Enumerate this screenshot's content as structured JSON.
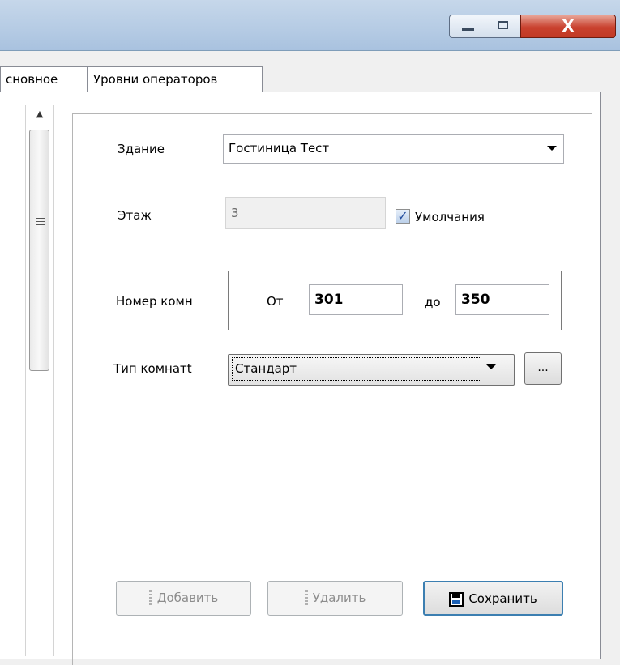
{
  "window": {
    "title_hint": "",
    "controls": {
      "minimize": "minimize",
      "maximize": "maximize",
      "close": "X"
    }
  },
  "tabs": [
    {
      "label": "сновное",
      "active": false
    },
    {
      "label": "Уровни операторов",
      "active": true
    }
  ],
  "form": {
    "building": {
      "label": "Здание",
      "value": "Гостиница Тест"
    },
    "floor": {
      "label": "Этаж",
      "value": "3"
    },
    "default_checkbox": {
      "label": "Умолчания",
      "checked": true
    },
    "room_number": {
      "label": "Номер комн",
      "from_label": "От",
      "from_value": "301",
      "to_label": "до",
      "to_value": "350"
    },
    "room_type": {
      "label": "Тип комнатt",
      "value": "Стандарт",
      "more_button": "..."
    }
  },
  "buttons": {
    "add": "Добавить",
    "delete": "Удалить",
    "save": "Сохранить"
  },
  "colors": {
    "save_border": "#3c7fb1",
    "checkbox_check": "#224c9d",
    "close_button": "#c9412e"
  }
}
